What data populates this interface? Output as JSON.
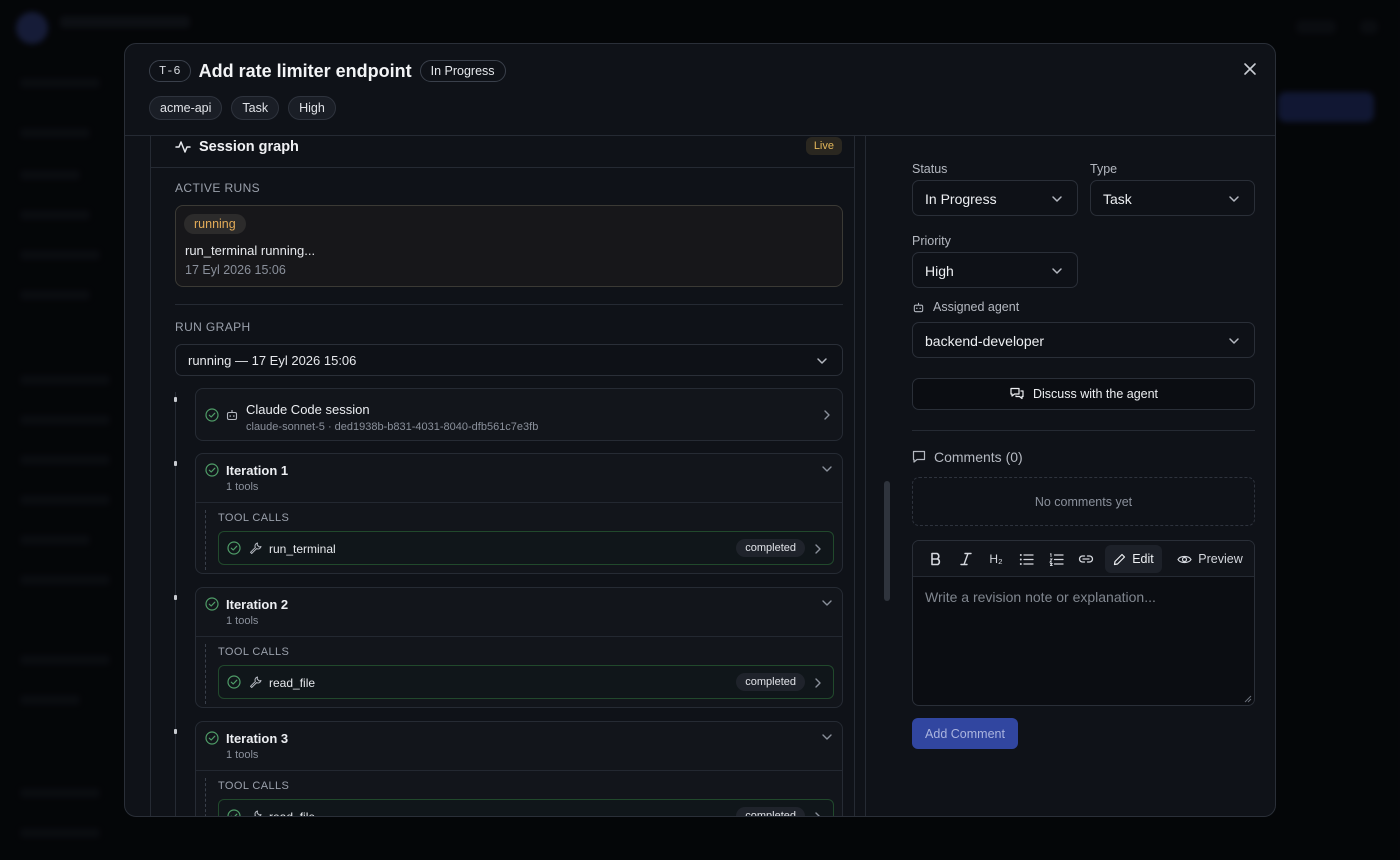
{
  "header": {
    "ticket_id": "T-6",
    "title": "Add rate limiter endpoint",
    "status": "In Progress",
    "tags": [
      "acme-api",
      "Task",
      "High"
    ]
  },
  "session_graph": {
    "title": "Session graph",
    "live_badge": "Live",
    "active_runs_label": "ACTIVE RUNS",
    "active_run": {
      "state": "running",
      "text": "run_terminal running...",
      "time": "17 Eyl 2026 15:06"
    },
    "run_graph_label": "RUN GRAPH",
    "run_select": "running — 17 Eyl 2026 15:06",
    "session_node": {
      "title": "Claude Code session",
      "subtitle": "claude-sonnet-5 · ded1938b-b831-4031-8040-dfb561c7e3fb"
    },
    "tool_calls_label": "TOOL CALLS",
    "iterations": [
      {
        "title": "Iteration 1",
        "subtitle": "1 tools",
        "tool": "run_terminal",
        "tool_status": "completed"
      },
      {
        "title": "Iteration 2",
        "subtitle": "1 tools",
        "tool": "read_file",
        "tool_status": "completed"
      },
      {
        "title": "Iteration 3",
        "subtitle": "1 tools",
        "tool": "read_file",
        "tool_status": "completed"
      }
    ]
  },
  "sidebar": {
    "status_label": "Status",
    "status_value": "In Progress",
    "type_label": "Type",
    "type_value": "Task",
    "priority_label": "Priority",
    "priority_value": "High",
    "agent_label": "Assigned agent",
    "agent_value": "backend-developer",
    "discuss_button": "Discuss with the agent",
    "comments_title": "Comments (0)",
    "no_comments": "No comments yet",
    "editor": {
      "edit_label": "Edit",
      "preview_label": "Preview",
      "heading_label": "H₂",
      "placeholder": "Write a revision note or explanation..."
    },
    "add_comment_button": "Add Comment"
  },
  "colors": {
    "accent": "#3146a0",
    "running": "#e2ab58",
    "completed_border": "#21492c",
    "check": "#4f9d68"
  }
}
